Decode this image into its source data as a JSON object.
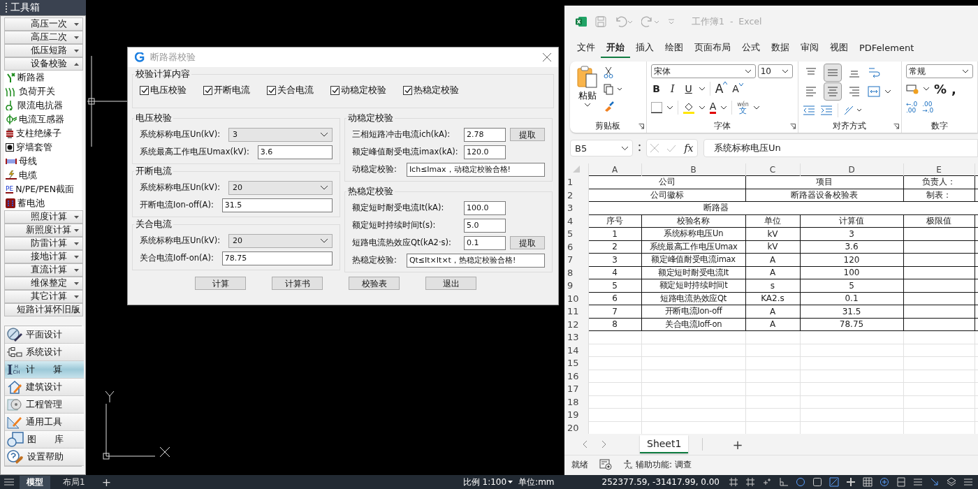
{
  "toolbox": {
    "title": "工具箱",
    "sections": [
      {
        "label": "高压一次",
        "expanded": false
      },
      {
        "label": "高压二次",
        "expanded": false
      },
      {
        "label": "低压短路",
        "expanded": false
      },
      {
        "label": "设备校验",
        "expanded": true,
        "items": [
          {
            "label": "断路器"
          },
          {
            "label": "负荷开关"
          },
          {
            "label": "限流电抗器"
          },
          {
            "label": "电流互感器"
          },
          {
            "label": "支柱绝缘子"
          },
          {
            "label": "穿墙套管"
          },
          {
            "label": "母线"
          },
          {
            "label": "电缆"
          },
          {
            "label": "N/PE/PEN截面",
            "icon_text": "PE"
          },
          {
            "label": "蓄电池"
          }
        ]
      },
      {
        "label": "照度计算",
        "expanded": false
      },
      {
        "label": "新照度计算",
        "expanded": false
      },
      {
        "label": "防雷计算",
        "expanded": false
      },
      {
        "label": "接地计算",
        "expanded": false
      },
      {
        "label": "直流计算",
        "expanded": false
      },
      {
        "label": "维保整定",
        "expanded": false
      },
      {
        "label": "其它计算",
        "expanded": false
      },
      {
        "label": "短路计算怀旧版",
        "expanded": false
      }
    ],
    "modules": [
      {
        "label": "平面设计",
        "selected": false
      },
      {
        "label": "系统设计",
        "selected": false
      },
      {
        "label": "计　　算",
        "selected": true,
        "icon_text": [
          "I",
          "H",
          "CH"
        ]
      },
      {
        "label": "建筑设计",
        "selected": false
      },
      {
        "label": "工程管理",
        "selected": false
      },
      {
        "label": "通用工具",
        "selected": false
      },
      {
        "label": "图　　库",
        "selected": false
      },
      {
        "label": "设置帮助",
        "selected": false
      }
    ]
  },
  "dialog": {
    "title": "断路器校验",
    "options": {
      "title": "校验计算内容",
      "checks": [
        {
          "label": "电压校验",
          "checked": true
        },
        {
          "label": "开断电流",
          "checked": true
        },
        {
          "label": "关合电流",
          "checked": true
        },
        {
          "label": "动稳定校验",
          "checked": true
        },
        {
          "label": "热稳定校验",
          "checked": true
        }
      ]
    },
    "left_groups": [
      {
        "title": "电压校验",
        "rows": [
          {
            "kind": "select",
            "label": "系统标称电压Un(kV):",
            "value": "3"
          },
          {
            "kind": "input",
            "label": "系统最高工作电压Umax(kV):",
            "value": "3.6"
          }
        ]
      },
      {
        "title": "开断电流",
        "rows": [
          {
            "kind": "select",
            "label": "系统标称电压Un(kV):",
            "value": "20"
          },
          {
            "kind": "input",
            "label": "开断电流Ion-off(A):",
            "value": "31.5"
          }
        ]
      },
      {
        "title": "关合电流",
        "rows": [
          {
            "kind": "select",
            "label": "系统标称电压Un(kV):",
            "value": "20"
          },
          {
            "kind": "input",
            "label": "关合电流Ioff-on(A):",
            "value": "78.75"
          }
        ]
      }
    ],
    "right_groups": [
      {
        "title": "动稳定校验",
        "rows": [
          {
            "kind": "input",
            "label": "三相短路冲击电流ich(kA):",
            "value": "2.78",
            "action": "提取"
          },
          {
            "kind": "input",
            "label": "额定峰值耐受电流imax(kA):",
            "value": "120.0"
          },
          {
            "kind": "result",
            "label": "动稳定校验:",
            "value": "Ich≤Imax，动稳定校验合格!"
          }
        ]
      },
      {
        "title": "热稳定校验",
        "rows": [
          {
            "kind": "input",
            "label": "额定短时耐受电流It(kA):",
            "value": "100.0"
          },
          {
            "kind": "input",
            "label": "额定短时持续时间t(s):",
            "value": "5.0"
          },
          {
            "kind": "input",
            "label": "短路电流热效应Qt(kA2·s):",
            "value": "0.1",
            "action": "提取"
          },
          {
            "kind": "result",
            "label": "热稳定校验:",
            "value": "Qt≤It×It×t，热稳定校验合格!"
          }
        ]
      }
    ],
    "buttons": [
      "计算",
      "计算书",
      "校验表",
      "退出"
    ]
  },
  "excel": {
    "title": "工作簿1  -  Excel",
    "tabs": [
      {
        "label": "文件",
        "selected": false
      },
      {
        "label": "开始",
        "selected": true
      },
      {
        "label": "插入",
        "selected": false
      },
      {
        "label": "绘图",
        "selected": false
      },
      {
        "label": "页面布局",
        "selected": false
      },
      {
        "label": "公式",
        "selected": false
      },
      {
        "label": "数据",
        "selected": false
      },
      {
        "label": "审阅",
        "selected": false
      },
      {
        "label": "视图",
        "selected": false
      },
      {
        "label": "PDFelement",
        "selected": false
      }
    ],
    "ribbon": [
      {
        "kind": "clipboard",
        "label": "剪贴板",
        "paste": "粘贴"
      },
      {
        "kind": "font",
        "label": "字体",
        "font": "宋体",
        "size": "10",
        "styles": [
          "B",
          "I",
          "U"
        ],
        "grow": "A",
        "shrink": "A",
        "color_letter": "A",
        "phonetic": [
          "wén",
          "文"
        ]
      },
      {
        "kind": "align",
        "label": "对齐方式",
        "vertical": [
          {
            "selected": false
          },
          {
            "selected": true
          },
          {
            "selected": false
          }
        ],
        "horizontal": [
          {
            "selected": false
          },
          {
            "selected": true
          },
          {
            "selected": false
          }
        ]
      },
      {
        "kind": "number",
        "label": "数字",
        "format": "常规",
        "symbols": [
          "%",
          ","
        ],
        "decimals": [
          [
            "←.0",
            ".00"
          ],
          [
            ".00",
            "→.0"
          ]
        ]
      }
    ],
    "name_box": "B5",
    "formula_label": "fx",
    "formula": "系统标称电压Un",
    "columns": [
      "A",
      "B",
      "C",
      "D",
      "E"
    ],
    "row_numbers": [
      "1",
      "2",
      "3",
      "4",
      "5",
      "6",
      "7",
      "8",
      "9",
      "10",
      "11",
      "12",
      "13",
      "14",
      "15",
      "16",
      "17",
      "18",
      "19",
      "20"
    ],
    "rows": [
      {
        "kind": "pairs",
        "cells": [
          "公司",
          "项目",
          "负责人："
        ]
      },
      {
        "kind": "pairs",
        "cells": [
          "公司徽标",
          "断路器设备校验表",
          "制表："
        ]
      },
      {
        "kind": "banner",
        "cells": [
          "断路器"
        ]
      },
      {
        "kind": "cells",
        "cells": [
          "序号",
          "校验名称",
          "单位",
          "计算值",
          "极限值"
        ]
      },
      {
        "kind": "cells",
        "cells": [
          "1",
          "系统标称电压Un",
          "kV",
          "3",
          ""
        ]
      },
      {
        "kind": "cells",
        "cells": [
          "2",
          "系统最高工作电压Umax",
          "kV",
          "3.6",
          ""
        ]
      },
      {
        "kind": "cells",
        "cells": [
          "3",
          "额定峰值耐受电流imax",
          "A",
          "120",
          ""
        ]
      },
      {
        "kind": "cells",
        "cells": [
          "4",
          "额定短时耐受电流It",
          "A",
          "100",
          ""
        ]
      },
      {
        "kind": "cells",
        "cells": [
          "5",
          "额定短时持续时间t",
          "s",
          "5",
          ""
        ]
      },
      {
        "kind": "cells",
        "cells": [
          "6",
          "短路电流热效应Qt",
          "KA2.s",
          "0.1",
          ""
        ]
      },
      {
        "kind": "cells",
        "cells": [
          "7",
          "开断电流Ion-off",
          "A",
          "31.5",
          ""
        ]
      },
      {
        "kind": "cells",
        "cells": [
          "8",
          "关合电流Ioff-on",
          "A",
          "78.75",
          ""
        ]
      },
      {
        "kind": "empty"
      },
      {
        "kind": "empty"
      },
      {
        "kind": "empty"
      },
      {
        "kind": "empty"
      },
      {
        "kind": "empty"
      },
      {
        "kind": "empty"
      },
      {
        "kind": "empty"
      },
      {
        "kind": "empty"
      }
    ],
    "sheets": [
      {
        "label": "Sheet1",
        "selected": true
      }
    ],
    "add_sheet": "+",
    "status": {
      "ready": "就绪",
      "accessibility": "辅助功能: 调查"
    }
  },
  "cad_status": {
    "tabs": [
      {
        "label": "模型",
        "selected": true
      },
      {
        "label": "布局1",
        "selected": false
      }
    ],
    "add": "+",
    "scale": "比例 1:100",
    "units": "单位:mm",
    "coords": "252377.59, -31417.99, 0.00"
  }
}
